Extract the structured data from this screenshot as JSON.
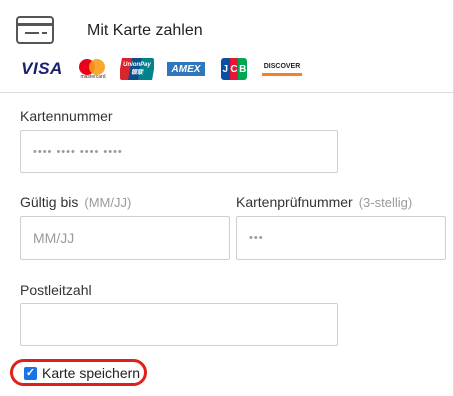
{
  "header": {
    "title": "Mit Karte zahlen",
    "brands": {
      "visa": "VISA",
      "mastercard": "mastercard",
      "unionpay": "UnionPay 银联",
      "amex": "AMEX",
      "jcb": [
        "J",
        "C",
        "B"
      ],
      "discover": "DISCOVER"
    }
  },
  "form": {
    "card_number": {
      "label": "Kartennummer",
      "placeholder": "•••• •••• •••• ••••"
    },
    "expiry": {
      "label": "Gültig bis",
      "hint": "(MM/JJ)",
      "placeholder": "MM/JJ"
    },
    "cvc": {
      "label": "Kartenprüfnummer",
      "hint": "(3-stellig)",
      "placeholder": "•••"
    },
    "postal": {
      "label": "Postleitzahl",
      "placeholder": ""
    },
    "save_card": {
      "label": "Karte speichern",
      "checked": true
    }
  },
  "colors": {
    "accent": "#1a73e8",
    "highlight": "#e0201a",
    "border": "#cfcfcf"
  }
}
